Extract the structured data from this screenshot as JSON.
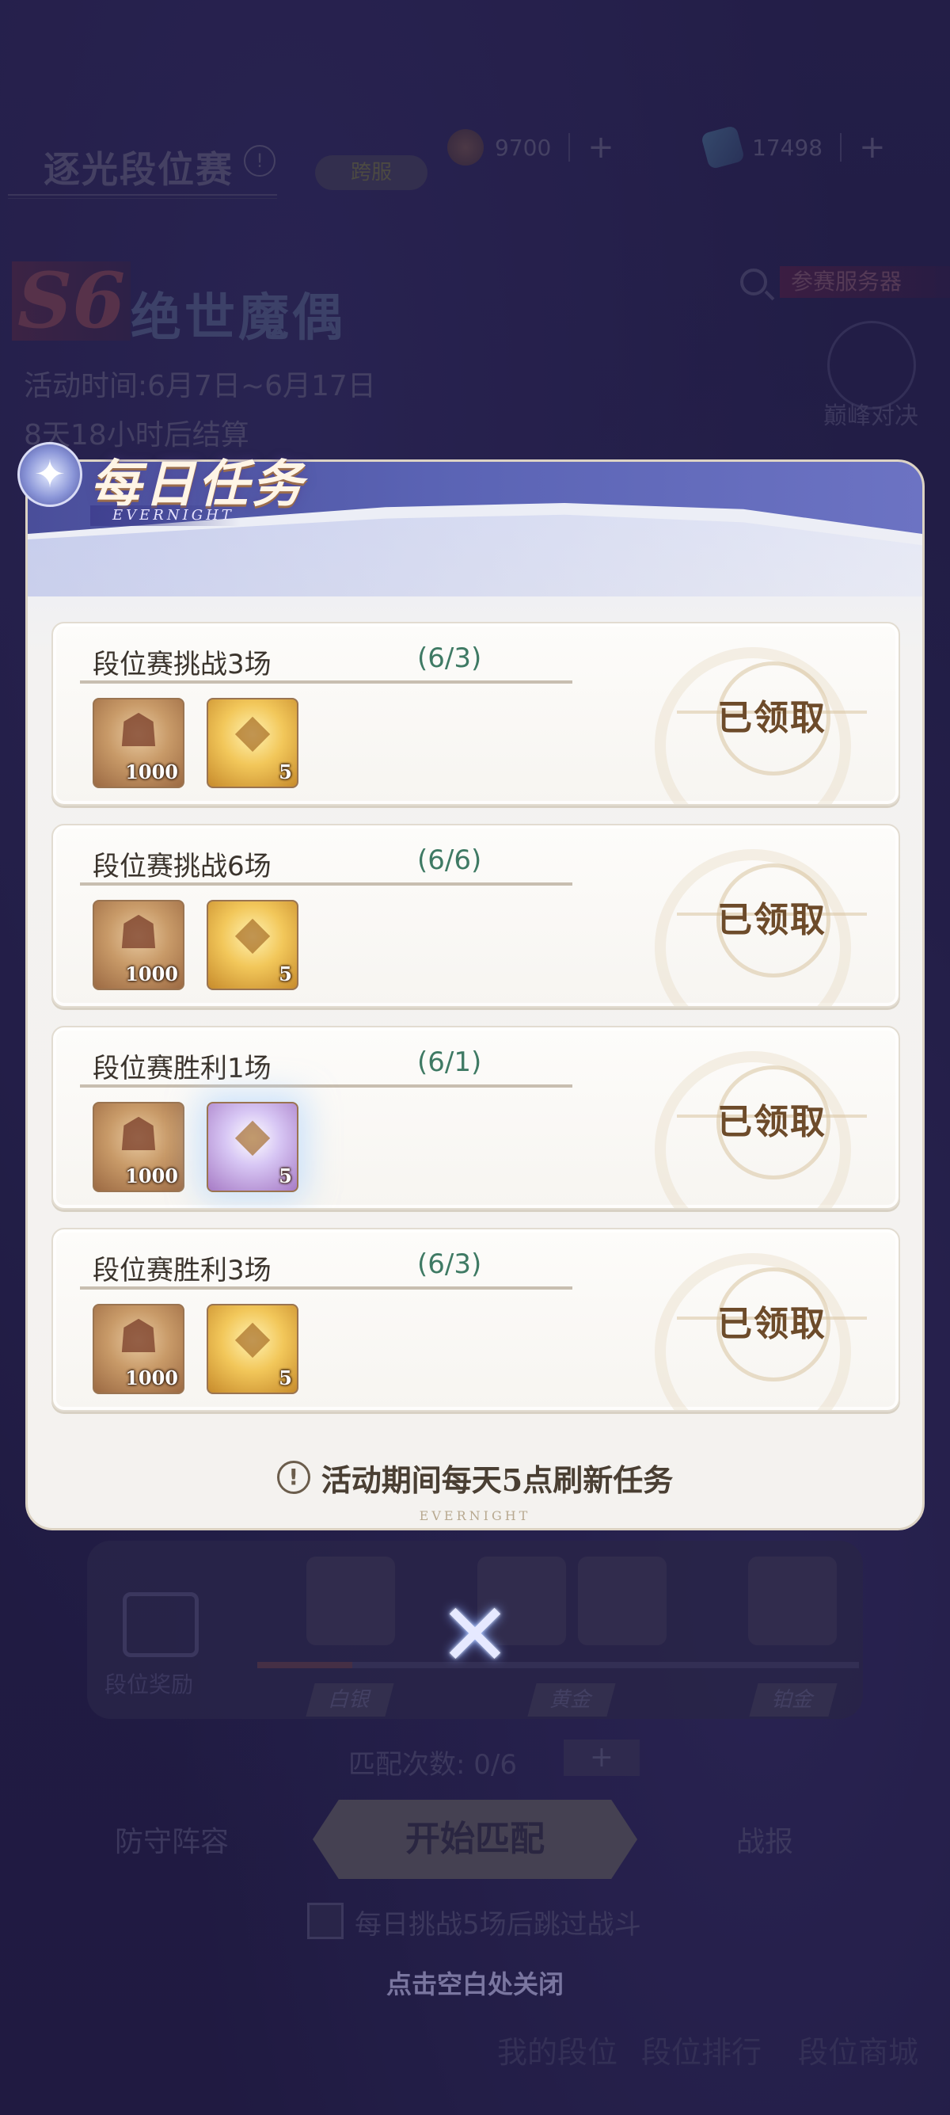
{
  "background": {
    "event_title": "逐光段位赛",
    "badge": "跨服",
    "currency": [
      {
        "icon": "coin-icon",
        "value": "9700",
        "plus": "+"
      },
      {
        "icon": "gem-icon",
        "value": "17498",
        "plus": "+"
      }
    ],
    "season_code": "S6",
    "season_name": "绝世魔偶",
    "event_time": "活动时间:6月7日~6月17日",
    "countdown": "8天18小时后结算",
    "search_label": "参赛服务器",
    "spar_label": "巅峰对决",
    "gift_label": "段位奖励",
    "tiers": [
      "白银",
      "黄金",
      "铂金"
    ],
    "match_count": "匹配次数: 0/6",
    "match_plus": "+",
    "lineup": "防守阵容",
    "start_match": "开始匹配",
    "battle_report": "战报",
    "skip_label": "每日挑战5场后跳过战斗",
    "close_hint": "点击空白处关闭",
    "nav": [
      "我的段位",
      "段位排行",
      "段位商城"
    ]
  },
  "dialog": {
    "title": "每日任务",
    "subtitle": "EVERNIGHT",
    "footer_mark": "EVERNIGHT",
    "notice": "活动期间每天5点刷新任务",
    "notice_icon": "!",
    "tasks": [
      {
        "name": "段位赛挑战3场",
        "progress": "(6/3)",
        "rewards": [
          {
            "icon": "mask-icon",
            "count": "1000"
          },
          {
            "icon": "gold-crystal-icon",
            "count": "5"
          }
        ],
        "status": "已领取"
      },
      {
        "name": "段位赛挑战6场",
        "progress": "(6/6)",
        "rewards": [
          {
            "icon": "mask-icon",
            "count": "1000"
          },
          {
            "icon": "gold-crystal-icon",
            "count": "5"
          }
        ],
        "status": "已领取"
      },
      {
        "name": "段位赛胜利1场",
        "progress": "(6/1)",
        "rewards": [
          {
            "icon": "mask-icon",
            "count": "1000"
          },
          {
            "icon": "gold-crystal-icon",
            "count": "5"
          }
        ],
        "status": "已领取"
      },
      {
        "name": "段位赛胜利3场",
        "progress": "(6/3)",
        "rewards": [
          {
            "icon": "mask-icon",
            "count": "1000"
          },
          {
            "icon": "gold-crystal-icon",
            "count": "5"
          }
        ],
        "status": "已领取"
      }
    ]
  },
  "close_icon": "close-icon",
  "colors": {
    "backdrop": "#2a2553",
    "header_blue": "#5a63b4",
    "progress_green": "#3f7a64",
    "claimed_brown": "#6d4b2a"
  }
}
